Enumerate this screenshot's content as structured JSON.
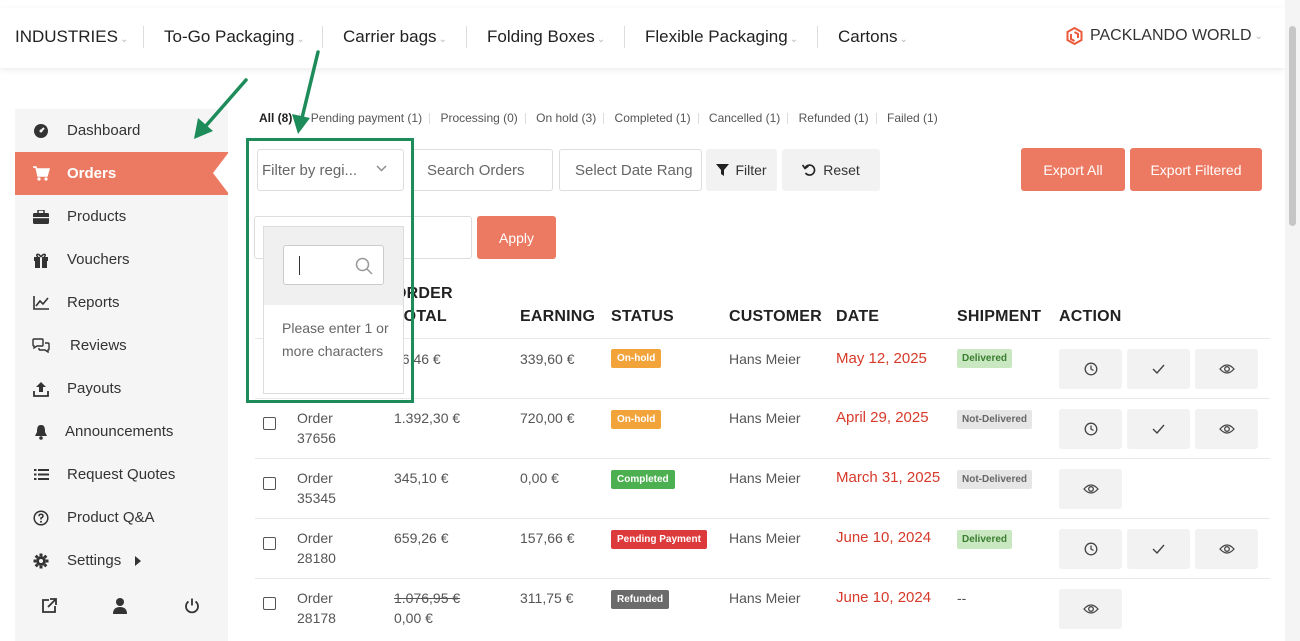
{
  "topnav": {
    "items": [
      {
        "label": "INDUSTRIES"
      },
      {
        "label": "To-Go Packaging"
      },
      {
        "label": "Carrier bags"
      },
      {
        "label": "Folding Boxes"
      },
      {
        "label": "Flexible Packaging"
      },
      {
        "label": "Cartons"
      }
    ],
    "brand": "PACKLANDO WORLD",
    "caret": "⌄"
  },
  "sidebar": {
    "items": [
      {
        "label": "Dashboard",
        "icon": "dashboard-icon"
      },
      {
        "label": "Orders",
        "icon": "cart-icon",
        "active": true
      },
      {
        "label": "Products",
        "icon": "briefcase-icon"
      },
      {
        "label": "Vouchers",
        "icon": "gift-icon"
      },
      {
        "label": "Reports",
        "icon": "chart-icon"
      },
      {
        "label": "Reviews",
        "icon": "comments-icon"
      },
      {
        "label": "Payouts",
        "icon": "upload-icon"
      },
      {
        "label": "Announcements",
        "icon": "bell-icon"
      },
      {
        "label": "Request Quotes",
        "icon": "list-icon"
      },
      {
        "label": "Product Q&A",
        "icon": "question-icon"
      },
      {
        "label": "Settings",
        "icon": "gear-icon"
      }
    ]
  },
  "status_tabs": [
    {
      "label": "All (8)"
    },
    {
      "label": "Pending payment (1)"
    },
    {
      "label": "Processing (0)"
    },
    {
      "label": "On hold (3)"
    },
    {
      "label": "Completed (1)"
    },
    {
      "label": "Cancelled (1)"
    },
    {
      "label": "Refunded (1)"
    },
    {
      "label": "Failed (1)"
    }
  ],
  "filters": {
    "region_placeholder": "Filter by regi...",
    "search_placeholder": "Search Orders",
    "date_placeholder": "Select Date Rang",
    "filter_label": "Filter",
    "reset_label": "Reset",
    "export_all_label": "Export All",
    "export_filtered_label": "Export Filtered",
    "apply_label": "Apply"
  },
  "dropdown": {
    "message": "Please enter 1 or more characters"
  },
  "table": {
    "headers": {
      "order_total_line1": "ORDER",
      "order_total_line2": "TOTAL",
      "earning": "EARNING",
      "status": "STATUS",
      "customer": "CUSTOMER",
      "date": "DATE",
      "shipment": "SHIPMENT",
      "action": "ACTION"
    },
    "rows": [
      {
        "order_line1": "",
        "order_line2": "",
        "total": "26,46 €",
        "earning": "339,60 €",
        "status": "On-hold",
        "status_color": "#f2a33a",
        "customer": "Hans Meier",
        "date": "May 12, 2025",
        "shipment": "Delivered"
      },
      {
        "order_line1": "Order",
        "order_line2": "37656",
        "total": "1.392,30 €",
        "earning": "720,00 €",
        "status": "On-hold",
        "status_color": "#f2a33a",
        "customer": "Hans Meier",
        "date": "April 29, 2025",
        "shipment": "Not-Delivered"
      },
      {
        "order_line1": "Order",
        "order_line2": "35345",
        "total": "345,10 €",
        "earning": "0,00 €",
        "status": "Completed",
        "status_color": "#4caf50",
        "customer": "Hans Meier",
        "date": "March 31, 2025",
        "shipment": "Not-Delivered"
      },
      {
        "order_line1": "Order",
        "order_line2": "28180",
        "total": "659,26 €",
        "earning": "157,66 €",
        "status": "Pending Payment",
        "status_color": "#dd3b3b",
        "customer": "Hans Meier",
        "date": "June 10, 2024",
        "shipment": "Delivered"
      },
      {
        "order_line1": "Order",
        "order_line2": "28178",
        "total": "1.076,95 €",
        "total_new": "0,00 €",
        "earning": "311,75 €",
        "status": "Refunded",
        "status_color": "#6b6b6b",
        "customer": "Hans Meier",
        "date": "June 10, 2024",
        "shipment": "--"
      }
    ]
  },
  "colors": {
    "accent": "#ec7a62",
    "date_red": "#d63a2a",
    "annotation_green": "#1e8c5a"
  }
}
